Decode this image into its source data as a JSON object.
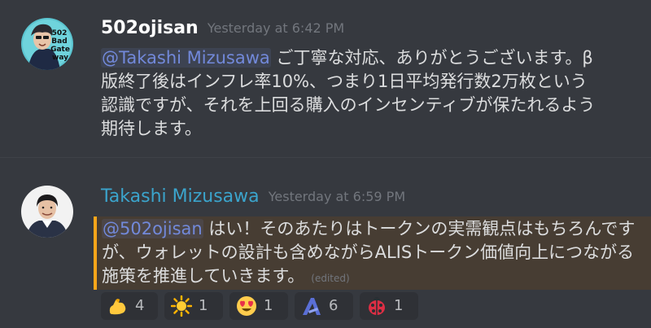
{
  "messages": [
    {
      "username": "502ojisan",
      "timestamp": "Yesterday at 6:42 PM",
      "avatar_text": [
        "502",
        "Bad",
        "Gate",
        "way"
      ],
      "mention": "@Takashi Mizusawa",
      "text": " ご丁寧な対応、ありがとうございます。β版終了後はインフレ率10%、つまり1日平均発行数2万枚という認識ですが、それを上回る購入のインセンティブが保たれるよう期待します。"
    },
    {
      "username": "Takashi Mizusawa",
      "timestamp": "Yesterday at 6:59 PM",
      "mention": "@502ojisan",
      "text": " はい！そのあたりはトークンの実需観点はもちろんですが、ウォレットの設計も含めながらALISトークン価値向上につながる施策を推進していきます。",
      "edited": "(edited)",
      "reactions": [
        {
          "icon": "flexed-biceps",
          "count": "4"
        },
        {
          "icon": "sun",
          "count": "1"
        },
        {
          "icon": "heart-eyes",
          "count": "1"
        },
        {
          "icon": "alis-logo",
          "count": "6"
        },
        {
          "icon": "ladybug",
          "count": "1"
        }
      ]
    }
  ],
  "colors": {
    "background": "#36393f",
    "mention": "#7289da",
    "highlight": "#473d33",
    "highlight_bar": "#faa61a",
    "username_blue": "#3ba4cc"
  }
}
